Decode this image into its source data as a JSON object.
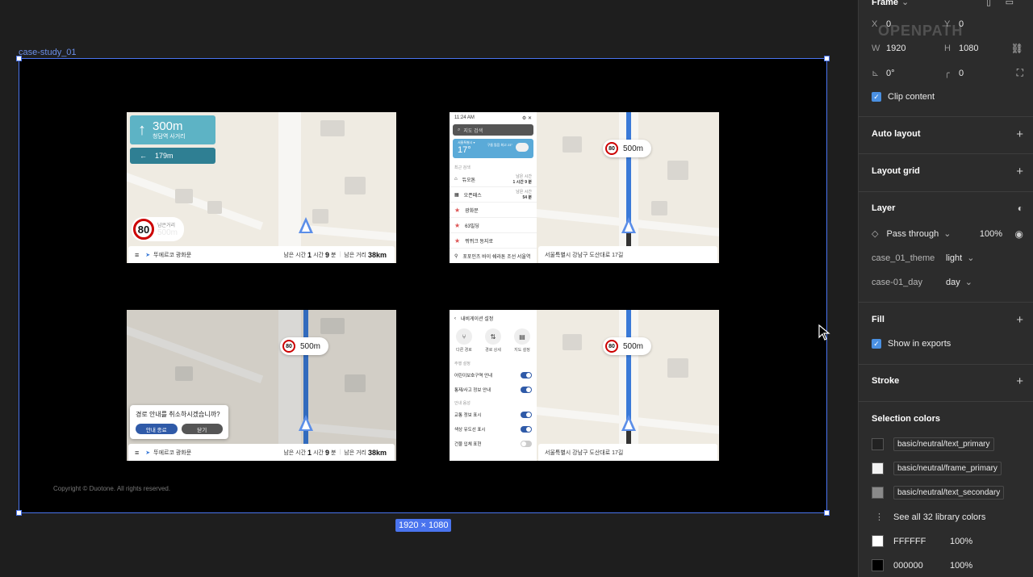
{
  "canvas": {
    "frame_label": "case-study_01",
    "size_badge": "1920 × 1080",
    "copyright": "Copyright © Duotone. All rights reserved."
  },
  "screen1": {
    "distance": "300m",
    "street": "청담역 사거리",
    "next_distance": "179m",
    "speed_limit": "80",
    "remaining_label": "남은거리",
    "remaining_value": "500m",
    "dest": "뚜에르코 광화문",
    "time_label": "남은 시간",
    "hours": "1",
    "hour_unit": "시간",
    "minutes": "9",
    "minute_unit": "분",
    "dist_label": "남은 거리",
    "dist_value": "38km"
  },
  "screen2": {
    "time": "11:24",
    "am": "AM",
    "search_placeholder": "지도 검색",
    "weather_loc": "서울특별시 ▾",
    "temp": "17°",
    "weather_info": "구름 많음 최고 23°",
    "recent_title": "최근 검색",
    "items": [
      {
        "name": "듀오톤",
        "meta1": "남은 시간",
        "meta2": "1 시간 9 분"
      },
      {
        "name": "오픈패스",
        "meta1": "남은 시간",
        "meta2": "54 분"
      },
      {
        "name": "광화문",
        "meta1": "",
        "meta2": ""
      },
      {
        "name": "63빌딩",
        "meta1": "",
        "meta2": ""
      },
      {
        "name": "뮈뮈크 동지로",
        "meta1": "",
        "meta2": ""
      },
      {
        "name": "포포인츠 바이 쉐라톤 조선 서울역",
        "meta1": "",
        "meta2": ""
      }
    ],
    "chip_speed": "80",
    "chip_dist": "500m",
    "address": "서울특별시 강남구 도산대로 17길"
  },
  "screen3": {
    "chip_speed": "80",
    "chip_dist": "500m",
    "dialog_text": "경로 안내를 취소하시겠습니까?",
    "btn_confirm": "안내 종료",
    "btn_close": "닫기",
    "dest": "뚜에르코 광화문",
    "time_label": "남은 시간",
    "hours": "1",
    "hour_unit": "시간",
    "minutes": "9",
    "minute_unit": "분",
    "dist_label": "남은 거리",
    "dist_value": "38km"
  },
  "screen4": {
    "title": "내비게이션 설정",
    "icons": [
      "다른 경로",
      "경로 상세",
      "지도 설정"
    ],
    "section1": "주행 설정",
    "toggles1": [
      "어린이보호구역 안내",
      "통제/사고 정보 안내"
    ],
    "section2": "안내 음성",
    "toggles2": [
      "교통 정보 표시",
      "색상 유도선 표시",
      "건물 입체 표현"
    ],
    "chip_speed": "80",
    "chip_dist": "500m",
    "address": "서울특별시 강남구 도산대로 17길"
  },
  "panel": {
    "frame_title": "Frame",
    "x_label": "X",
    "x_value": "0",
    "y_label": "Y",
    "y_value": "0",
    "w_label": "W",
    "w_value": "1920",
    "h_label": "H",
    "h_value": "1080",
    "rotation": "0°",
    "radius": "0",
    "clip_content": "Clip content",
    "auto_layout": "Auto layout",
    "layout_grid": "Layout grid",
    "layer": "Layer",
    "blend_mode": "Pass through",
    "opacity": "100%",
    "theme_label": "case_01_theme",
    "theme_value": "light",
    "day_label": "case-01_day",
    "day_value": "day",
    "fill": "Fill",
    "show_exports": "Show in exports",
    "stroke": "Stroke",
    "selection_colors": "Selection colors",
    "library_colors": [
      {
        "name": "basic/neutral/text_primary",
        "color": "#222222"
      },
      {
        "name": "basic/neutral/frame_primary",
        "color": "#f2f2f2"
      },
      {
        "name": "basic/neutral/text_secondary",
        "color": "#8a8a8a"
      }
    ],
    "see_all": "See all 32 library colors",
    "colors": [
      {
        "hex": "FFFFFF",
        "opacity": "100%",
        "color": "#ffffff"
      },
      {
        "hex": "000000",
        "opacity": "100%",
        "color": "#000000"
      }
    ],
    "watermark": "OPENPATH"
  }
}
